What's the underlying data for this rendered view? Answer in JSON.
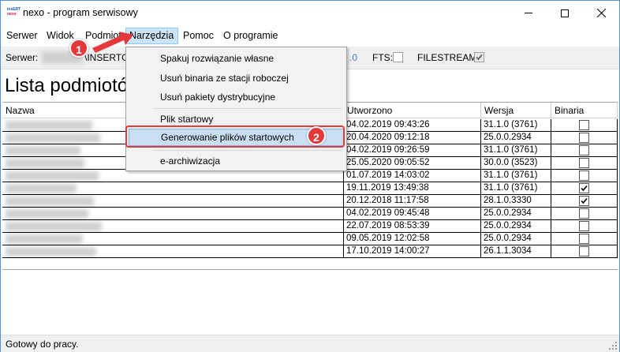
{
  "window": {
    "title": "nexo - program serwisowy",
    "logo_top": "insERT",
    "logo_bottom": "nexo"
  },
  "menubar": {
    "items": [
      {
        "label": "Serwer"
      },
      {
        "label": "Widok"
      },
      {
        "label": "Podmiot"
      },
      {
        "label": "Narzędzia"
      },
      {
        "label": "Pomoc"
      },
      {
        "label": "O programie"
      }
    ],
    "active_index": 3
  },
  "toolbar": {
    "server_label": "Serwer:",
    "instance_partial": "\\INSERTG",
    "version_partial": ".0",
    "fts_label": "FTS:",
    "fts_checked": false,
    "filestream_label": "FILESTREAM:",
    "filestream_checked": true
  },
  "page": {
    "heading": "Lista podmiotó"
  },
  "grid": {
    "columns": {
      "nazwa": "Nazwa",
      "utworzono": "Utworzono",
      "wersja": "Wersja",
      "binaria": "Binaria"
    },
    "rows": [
      {
        "utworzono": "04.02.2019 09:43:26",
        "wersja": "31.1.0 (3761)",
        "binaria": false
      },
      {
        "utworzono": "20.04.2020 09:12:18",
        "wersja": "25.0.0.2934",
        "binaria": false
      },
      {
        "utworzono": "04.02.2019 09:26:59",
        "wersja": "31.1.0 (3761)",
        "binaria": false
      },
      {
        "utworzono": "25.05.2020 09:05:52",
        "wersja": "30.0.0 (3523)",
        "binaria": false
      },
      {
        "utworzono": "01.07.2019 14:03:02",
        "wersja": "31.1.0 (3761)",
        "binaria": false
      },
      {
        "utworzono": "19.11.2019 13:49:38",
        "wersja": "31.1.0 (3761)",
        "binaria": true
      },
      {
        "utworzono": "20.12.2018 11:17:58",
        "wersja": "28.1.0.3330",
        "binaria": true
      },
      {
        "utworzono": "04.02.2019 09:45:48",
        "wersja": "25.0.0.2934",
        "binaria": false
      },
      {
        "utworzono": "22.07.2019 08:53:39",
        "wersja": "25.0.0.2934",
        "binaria": false
      },
      {
        "utworzono": "09.05.2019 12:02:58",
        "wersja": "25.0.0.2934",
        "binaria": false
      },
      {
        "utworzono": "17.10.2019 14:00:27",
        "wersja": "26.1.1.3034",
        "binaria": false
      }
    ]
  },
  "dropdown": {
    "items": [
      {
        "label": "Spakuj rozwiązanie własne"
      },
      {
        "label": "Usuń binaria ze stacji roboczej"
      },
      {
        "label": "Usuń pakiety dystrybucyjne"
      },
      {
        "label": "Plik startowy"
      },
      {
        "label": "Generowanie plików startowych"
      },
      {
        "label": "e-archiwizacja"
      }
    ],
    "highlighted_index": 4
  },
  "callouts": {
    "first": "1",
    "second": "2",
    "color": "#e5383b"
  },
  "statusbar": {
    "text": "Gotowy do pracy."
  }
}
